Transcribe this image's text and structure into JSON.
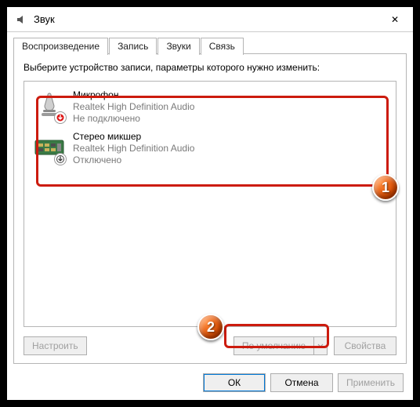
{
  "window": {
    "title": "Звук",
    "close_label": "✕"
  },
  "tabs": {
    "t0": "Воспроизведение",
    "t1": "Запись",
    "t2": "Звуки",
    "t3": "Связь"
  },
  "panel": {
    "instruction": "Выберите устройство записи, параметры которого нужно изменить:",
    "configure": "Настроить",
    "default": "По умолчанию",
    "properties": "Свойства"
  },
  "devices": [
    {
      "name": "Микрофон",
      "controller": "Realtek High Definition Audio",
      "status": "Не подключено"
    },
    {
      "name": "Стерео микшер",
      "controller": "Realtek High Definition Audio",
      "status": "Отключено"
    }
  ],
  "dialog_buttons": {
    "ok": "ОК",
    "cancel": "Отмена",
    "apply": "Применить"
  },
  "annotations": {
    "m1": "1",
    "m2": "2"
  }
}
